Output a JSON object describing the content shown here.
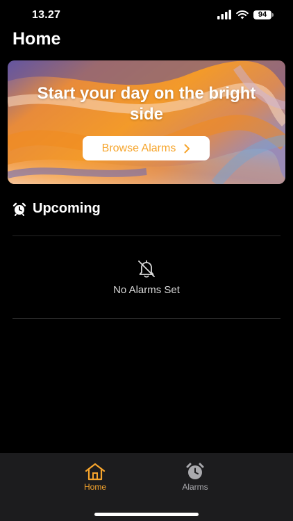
{
  "status_bar": {
    "time": "13.27",
    "battery": "94"
  },
  "header": {
    "title": "Home"
  },
  "hero": {
    "headline": "Start your day on the bright side",
    "button_label": "Browse Alarms"
  },
  "upcoming": {
    "title": "Upcoming",
    "empty_text": "No Alarms Set"
  },
  "tab_bar": {
    "tabs": [
      {
        "label": "Home",
        "icon": "house-icon",
        "active": true
      },
      {
        "label": "Alarms",
        "icon": "alarm-clock-icon",
        "active": false
      }
    ]
  },
  "colors": {
    "accent": "#f7a52d",
    "background": "#000000",
    "tab_bar": "#1c1c1e",
    "inactive_tab": "#a9a9ad"
  }
}
